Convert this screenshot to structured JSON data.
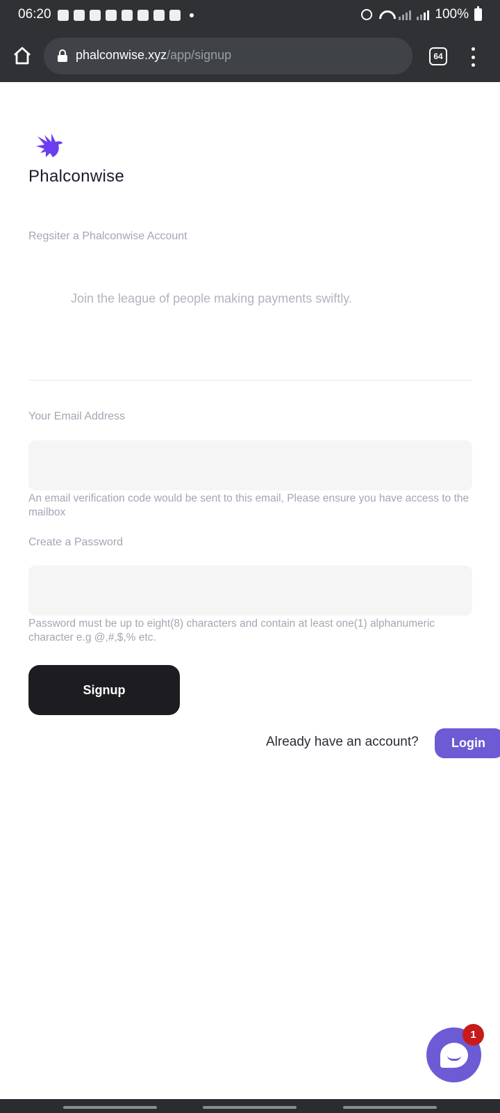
{
  "status_bar": {
    "time": "06:20",
    "battery": "100%",
    "notification_icons": [
      "snapchat-icon",
      "chat-icon",
      "hand-icon",
      "tiktok-icon",
      "tiktok-icon",
      "stocks-icon",
      "target-icon",
      "target-icon"
    ]
  },
  "browser": {
    "url_host": "phalconwise.xyz",
    "url_path": "/app/signup",
    "tab_count": "64"
  },
  "page": {
    "brand_name": "Phalconwise",
    "subtitle": "Regsiter a Phalconwise Account",
    "tagline": "Join the league of people making payments swiftly.",
    "email": {
      "label": "Your Email Address",
      "value": "",
      "hint": "An email verification code would be sent to this email, Please ensure you have access to the mailbox"
    },
    "password": {
      "label": "Create a Password",
      "value": "",
      "hint": "Password must be up to eight(8) characters and contain at least one(1) alphanumeric character e.g @,#,$,% etc."
    },
    "signup_label": "Signup",
    "already_text": "Already have an account?",
    "login_label": "Login"
  },
  "chat": {
    "badge_count": "1"
  },
  "colors": {
    "accent": "#6c5bd4",
    "button_dark": "#1c1c21",
    "badge": "#c71a1a",
    "logo": "#6a3df0"
  }
}
